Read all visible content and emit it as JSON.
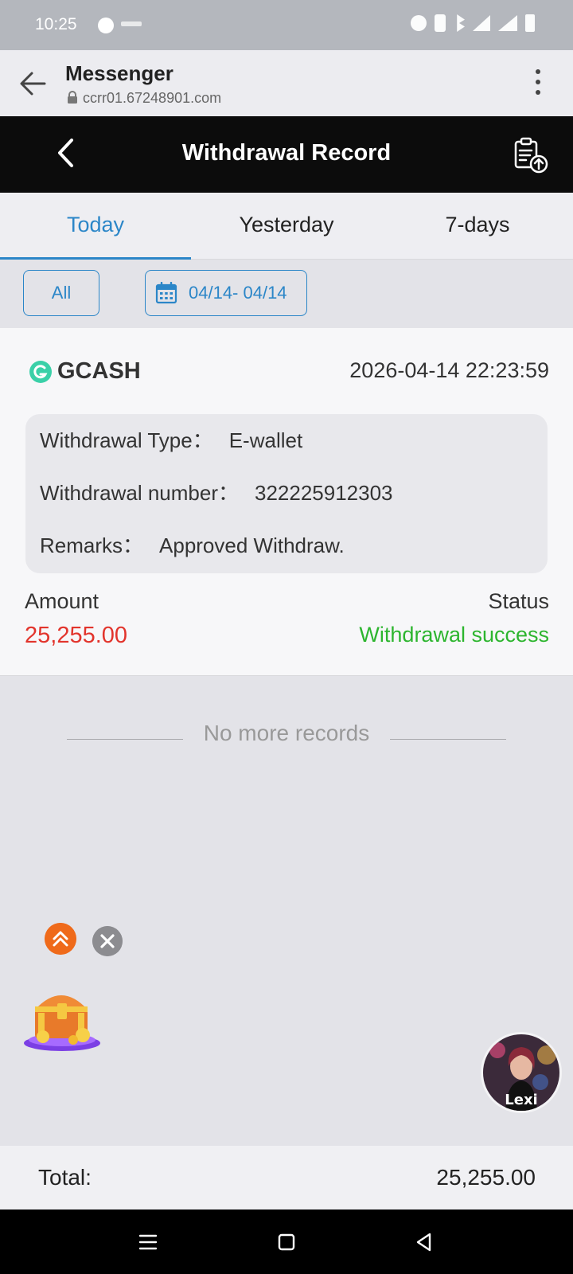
{
  "status_bar": {
    "time": "10:25",
    "icons": [
      "messenger-icon",
      "alarm-icon",
      "vibrate-icon",
      "bluetooth-icon",
      "signal-icon",
      "signal-icon",
      "battery-icon"
    ]
  },
  "browser": {
    "title": "Messenger",
    "url": "ccrr01.67248901.com"
  },
  "app_header": {
    "title": "Withdrawal Record"
  },
  "tabs": [
    {
      "label": "Today",
      "active": true
    },
    {
      "label": "Yesterday",
      "active": false
    },
    {
      "label": "7-days",
      "active": false
    }
  ],
  "filters": {
    "all_label": "All",
    "date_range": "04/14- 04/14"
  },
  "record": {
    "provider": "GCASH",
    "datetime": "2026-04-14 22:23:59",
    "type_label": "Withdrawal Type：",
    "type_value": "E-wallet",
    "number_label": "Withdrawal number：",
    "number_value": "322225912303",
    "remarks_label": "Remarks：",
    "remarks_value": "Approved Withdraw.",
    "amount_label": "Amount",
    "amount_value": "25,255.00",
    "status_label": "Status",
    "status_value": "Withdrawal success"
  },
  "no_more_text": "No more records",
  "avatar_name": "Lexi",
  "total": {
    "label": "Total:",
    "value": "25,255.00"
  },
  "colors": {
    "accent": "#2b86c8",
    "amount": "#e2342c",
    "success": "#2db52f",
    "header_bg": "#0c0c0c"
  }
}
